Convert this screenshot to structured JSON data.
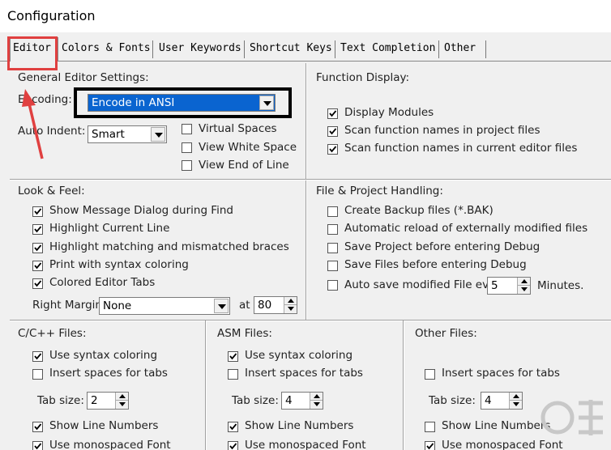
{
  "window": {
    "title": "Configuration"
  },
  "tabs": [
    {
      "label": "Editor",
      "active": true
    },
    {
      "label": "Colors & Fonts"
    },
    {
      "label": "User Keywords"
    },
    {
      "label": "Shortcut Keys"
    },
    {
      "label": "Text Completion"
    },
    {
      "label": "Other"
    }
  ],
  "general": {
    "title": "General Editor Settings:",
    "encoding_label": "Encoding:",
    "encoding_value": "Encode in ANSI",
    "auto_indent_label": "Auto Indent:",
    "auto_indent_value": "Smart",
    "virtual_spaces": "Virtual Spaces",
    "view_white_space": "View White Space",
    "view_end_of_line": "View End of Line"
  },
  "function_display": {
    "title": "Function Display:",
    "display_modules": "Display Modules",
    "scan_project": "Scan function names in project files",
    "scan_current": "Scan function names in current editor files"
  },
  "look_feel": {
    "title": "Look & Feel:",
    "items": [
      "Show Message Dialog during Find",
      "Highlight Current Line",
      "Highlight matching and mismatched braces",
      "Print with syntax coloring",
      "Colored Editor Tabs"
    ],
    "right_margin_label": "Right Margin:",
    "right_margin_value": "None",
    "at_label": "at",
    "at_value": "80"
  },
  "file_project": {
    "title": "File & Project Handling:",
    "items": [
      "Create Backup files (*.BAK)",
      "Automatic reload of externally modified files",
      "Save Project before entering Debug",
      "Save Files before entering Debug",
      "Auto save modified File every"
    ],
    "autosave_value": "5",
    "minutes_label": "Minutes."
  },
  "cpp": {
    "title": "C/C++ Files:",
    "syntax": "Use syntax coloring",
    "insert_spaces": "Insert spaces for tabs",
    "tab_size_label": "Tab size:",
    "tab_size": "2",
    "line_numbers": "Show Line Numbers",
    "monospaced": "Use monospaced Font"
  },
  "asm": {
    "title": "ASM Files:",
    "syntax": "Use syntax coloring",
    "insert_spaces": "Insert spaces for tabs",
    "tab_size_label": "Tab size:",
    "tab_size": "4",
    "line_numbers": "Show Line Numbers",
    "monospaced": "Use monospaced Font"
  },
  "other": {
    "title": "Other Files:",
    "insert_spaces": "Insert spaces for tabs",
    "tab_size_label": "Tab size:",
    "tab_size": "4",
    "line_numbers": "Show Line Numbers",
    "monospaced": "Use monospaced Font"
  },
  "colors": {
    "highlight": "#0a64d0",
    "annotation_red": "#e04040"
  }
}
